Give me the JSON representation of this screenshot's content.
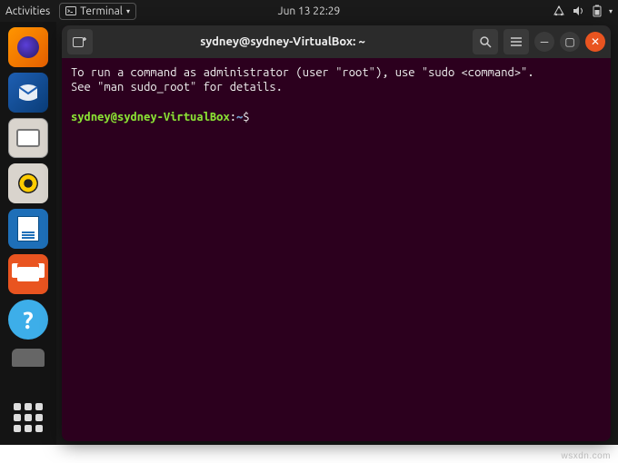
{
  "topbar": {
    "activities": "Activities",
    "app_label": "Terminal",
    "datetime": "Jun 13  22:29"
  },
  "dock": {
    "items": [
      "firefox",
      "thunderbird",
      "files",
      "rhythmbox",
      "writer",
      "software",
      "help"
    ]
  },
  "window": {
    "title": "sydney@sydney-VirtualBox: ~",
    "new_tab_icon": "new-tab-icon",
    "search_icon": "search-icon",
    "menu_icon": "hamburger-icon"
  },
  "terminal": {
    "line1": "To run a command as administrator (user \"root\"), use \"sudo <command>\".",
    "line2": "See \"man sudo_root\" for details.",
    "prompt_user": "sydney@sydney-VirtualBox",
    "prompt_sep": ":",
    "prompt_path": "~",
    "prompt_suffix": "$ "
  },
  "watermark": "wsxdn.com"
}
